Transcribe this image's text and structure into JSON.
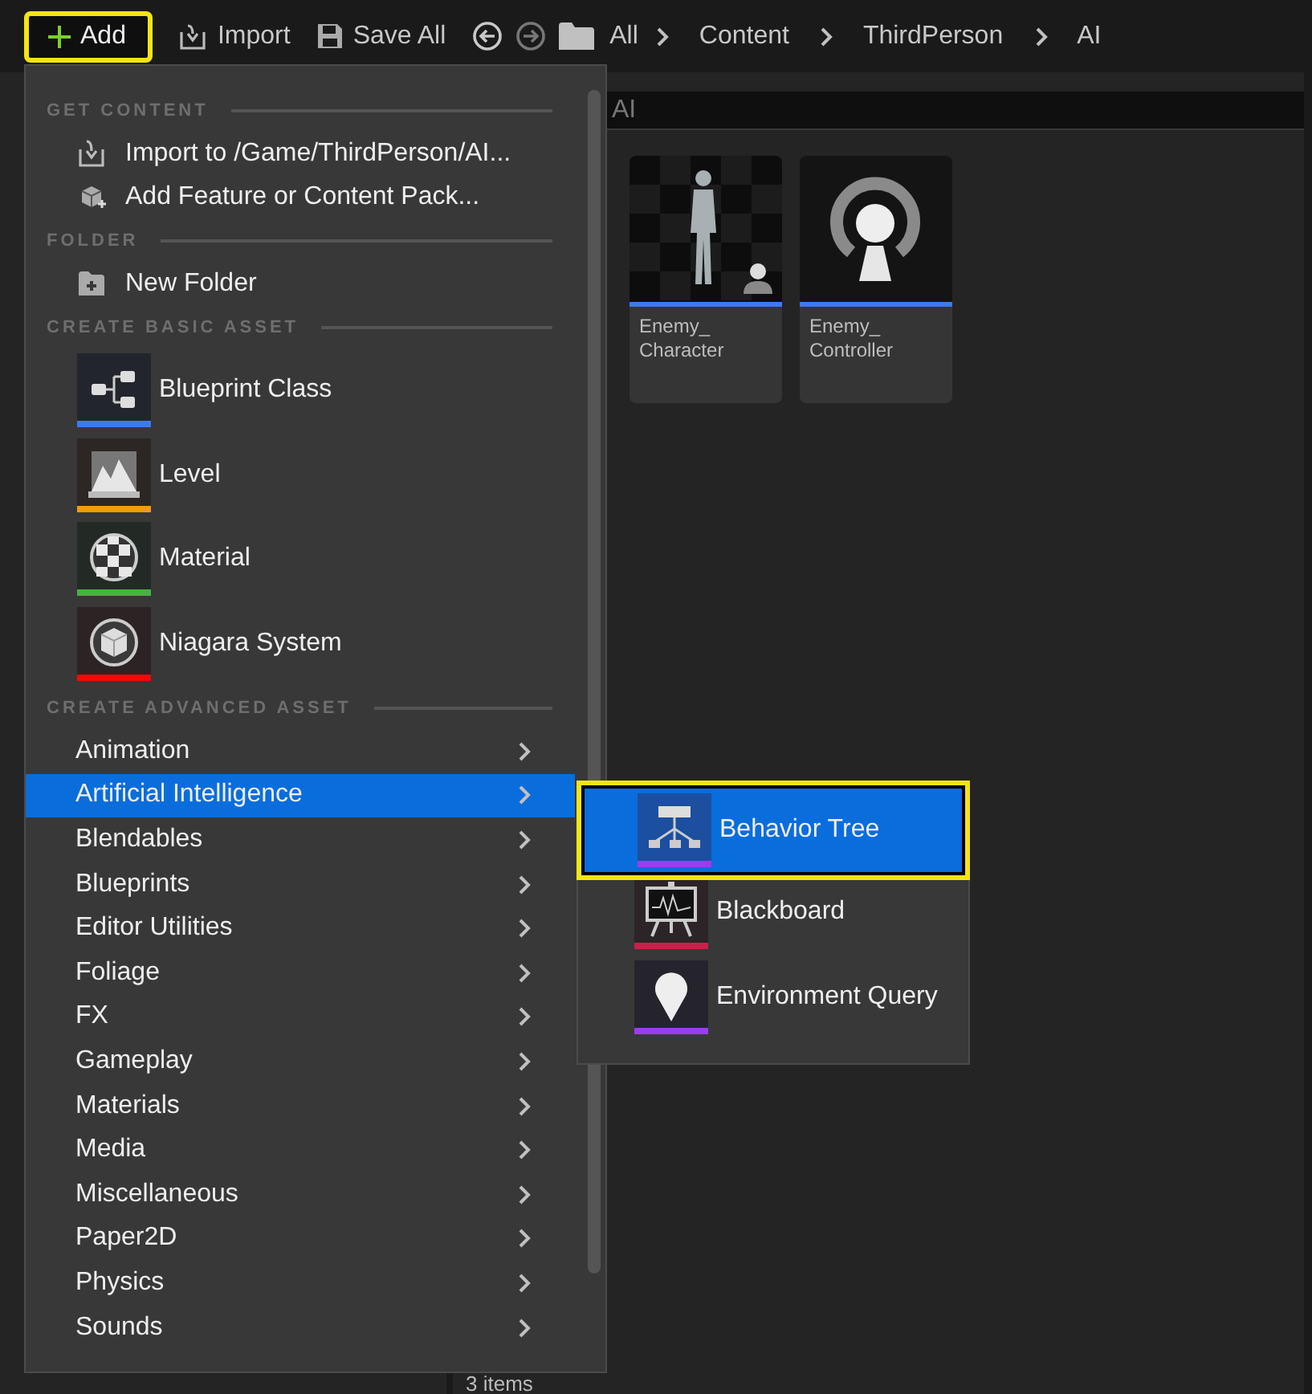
{
  "toolbar": {
    "add_button": {
      "label": "Add",
      "highlighted": true
    },
    "import_button": "Import",
    "save_all_button": "Save All",
    "breadcrumb": [
      "All",
      "Content",
      "ThirdPerson",
      "AI"
    ]
  },
  "search": {
    "value": "AI"
  },
  "assets": [
    {
      "name_lines": [
        "Enemy_",
        "Character"
      ],
      "color": "#3b7bf0",
      "kind": "picture"
    },
    {
      "name_lines": [
        "Enemy_",
        "Controller"
      ],
      "color": "#3b7bf0",
      "kind": "controller"
    }
  ],
  "status_bar": {
    "item_count": "3 items"
  },
  "add_menu": {
    "sections": [
      {
        "header": "GET CONTENT",
        "items": [
          {
            "kind": "action",
            "label": "Import to /Game/ThirdPerson/AI..."
          },
          {
            "kind": "action",
            "label": "Add Feature or Content Pack..."
          }
        ]
      },
      {
        "header": "FOLDER",
        "items": [
          {
            "kind": "action",
            "label": "New Folder"
          }
        ]
      },
      {
        "header": "CREATE BASIC ASSET",
        "items": [
          {
            "kind": "asset",
            "label": "Blueprint Class",
            "color": "#3b7bf0"
          },
          {
            "kind": "asset",
            "label": "Level",
            "color": "#f59a0a"
          },
          {
            "kind": "asset",
            "label": "Material",
            "color": "#45b343"
          },
          {
            "kind": "asset",
            "label": "Niagara System",
            "color": "#f00a0a"
          }
        ]
      },
      {
        "header": "CREATE ADVANCED ASSET",
        "items": [
          {
            "kind": "category",
            "label": "Animation",
            "selected": false
          },
          {
            "kind": "category",
            "label": "Artificial Intelligence",
            "selected": true
          },
          {
            "kind": "category",
            "label": "Blendables",
            "selected": false
          },
          {
            "kind": "category",
            "label": "Blueprints",
            "selected": false
          },
          {
            "kind": "category",
            "label": "Editor Utilities",
            "selected": false
          },
          {
            "kind": "category",
            "label": "Foliage",
            "selected": false
          },
          {
            "kind": "category",
            "label": "FX",
            "selected": false
          },
          {
            "kind": "category",
            "label": "Gameplay",
            "selected": false
          },
          {
            "kind": "category",
            "label": "Materials",
            "selected": false
          },
          {
            "kind": "category",
            "label": "Media",
            "selected": false
          },
          {
            "kind": "category",
            "label": "Miscellaneous",
            "selected": false
          },
          {
            "kind": "category",
            "label": "Paper2D",
            "selected": false
          },
          {
            "kind": "category",
            "label": "Physics",
            "selected": false
          },
          {
            "kind": "category",
            "label": "Sounds",
            "selected": false
          }
        ]
      }
    ]
  },
  "submenu": {
    "items": [
      {
        "label": "Behavior Tree",
        "color": "#9b3cf0",
        "selected": true
      },
      {
        "label": "Blackboard",
        "color": "#c8204a",
        "selected": false
      },
      {
        "label": "Environment Query",
        "color": "#9b3cf0",
        "selected": false
      }
    ]
  }
}
